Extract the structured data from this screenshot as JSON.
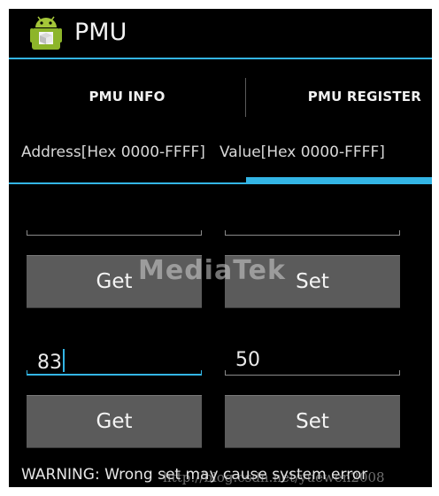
{
  "app": {
    "title": "PMU",
    "icon": "android-robot-icon"
  },
  "tabs": [
    {
      "label": "PMU INFO",
      "selected": false
    },
    {
      "label": "PMU REGISTER",
      "selected": true
    }
  ],
  "labels": {
    "address": "Address[Hex 0000-FFFF]",
    "value": "Value[Hex 0000-FFFF]"
  },
  "row1": {
    "address_value": "",
    "value_value": "",
    "get_label": "Get",
    "set_label": "Set"
  },
  "row2": {
    "address_value": "83",
    "value_value": "50",
    "get_label": "Get",
    "set_label": "Set"
  },
  "warning": "WARNING: Wrong set may cause system error",
  "watermarks": {
    "logo": "MediaTek",
    "url": "http://blog.csdn.net/yuewen2008"
  },
  "colors": {
    "accent": "#33b5e5",
    "button": "#5b5b5b",
    "background": "#000000"
  }
}
